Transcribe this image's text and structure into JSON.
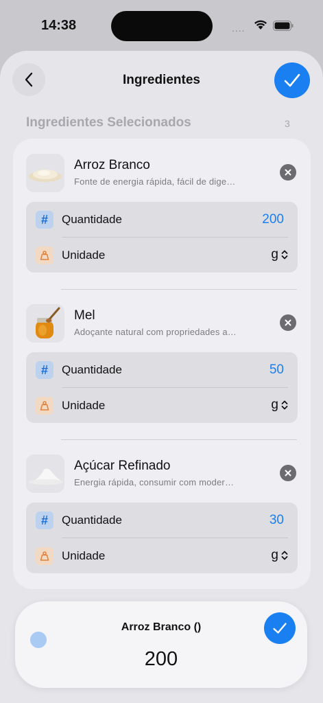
{
  "status_bar": {
    "time": "14:38",
    "signal": "....",
    "wifi_icon": "wifi-icon",
    "battery_icon": "battery-icon"
  },
  "nav": {
    "back_icon": "chevron-left-icon",
    "title": "Ingredientes",
    "confirm_icon": "checkmark-icon"
  },
  "section": {
    "title": "Ingredientes Selecionados",
    "count": "3"
  },
  "ingredients": [
    {
      "name": "Arroz Branco",
      "description": "Fonte de energia rápida, fácil de dige…",
      "image": "rice-image",
      "quantity_label": "Quantidade",
      "quantity": "200",
      "unit_label": "Unidade",
      "unit": "g"
    },
    {
      "name": "Mel",
      "description": "Adoçante natural com propriedades a…",
      "image": "honey-jar-image",
      "quantity_label": "Quantidade",
      "quantity": "50",
      "unit_label": "Unidade",
      "unit": "g"
    },
    {
      "name": "Açúcar Refinado",
      "description": "Energia rápida, consumir com moder…",
      "image": "sugar-pile-image",
      "quantity_label": "Quantidade",
      "quantity": "30",
      "unit_label": "Unidade",
      "unit": "g"
    }
  ],
  "icons": {
    "quantity_glyph": "#",
    "remove_icon": "xmark-circle-icon",
    "unit_icon": "weight-icon",
    "chevron_updown_icon": "chevron-up-down-icon"
  },
  "bottom_pill": {
    "title": "Arroz Branco ()",
    "value": "200",
    "confirm_icon": "checkmark-icon"
  },
  "colors": {
    "accent": "#1a7ff0",
    "background": "#c9c8cd",
    "sheet": "#e6e5ea",
    "card": "#efeef3"
  }
}
